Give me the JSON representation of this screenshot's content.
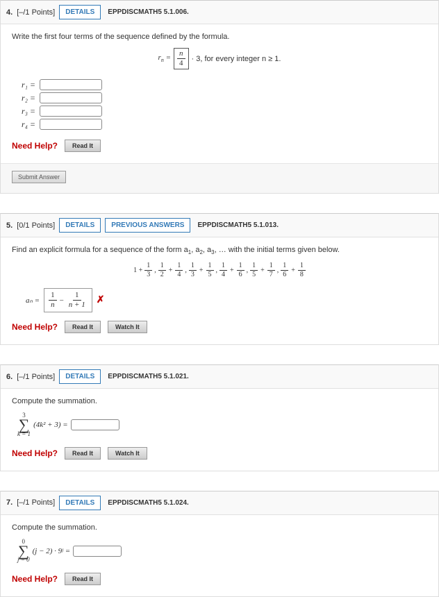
{
  "common": {
    "details_label": "DETAILS",
    "prev_answers_label": "PREVIOUS ANSWERS",
    "need_help_label": "Need Help?",
    "read_it_label": "Read It",
    "watch_it_label": "Watch It",
    "submit_label": "Submit Answer"
  },
  "q4": {
    "num": "4.",
    "pts": "[–/1 Points]",
    "ref": "EPPDISCMATH5 5.1.006.",
    "prompt": "Write the first four terms of the sequence defined by the formula.",
    "formula_after": "· 3, for every integer n ≥ 1.",
    "r_sym": "r",
    "n_sym": "n",
    "four": "4",
    "rows": [
      "r₁ =",
      "r₂ =",
      "r₃ =",
      "r₄ ="
    ]
  },
  "q5": {
    "num": "5.",
    "pts": "[0/1 Points]",
    "ref": "EPPDISCMATH5 5.1.013.",
    "prompt_a": "Find an explicit formula for a sequence of the form a",
    "prompt_b": ", a",
    "prompt_c": ", a",
    "prompt_d": ", … with the initial terms given below.",
    "series_lead": "1 +",
    "an": "aₙ =",
    "ans_num1": "1",
    "ans_den1": "n",
    "ans_minus": "−",
    "ans_num2": "1",
    "ans_den2": "n + 1"
  },
  "q6": {
    "num": "6.",
    "pts": "[–/1 Points]",
    "ref": "EPPDISCMATH5 5.1.021.",
    "prompt": "Compute the summation.",
    "upper": "3",
    "lower": "k = 1",
    "expr": "(4k² + 3) ="
  },
  "q7": {
    "num": "7.",
    "pts": "[–/1 Points]",
    "ref": "EPPDISCMATH5 5.1.024.",
    "prompt": "Compute the summation.",
    "upper": "0",
    "lower": "j = 0",
    "expr": "(j − 2) · 9ʲ ="
  }
}
